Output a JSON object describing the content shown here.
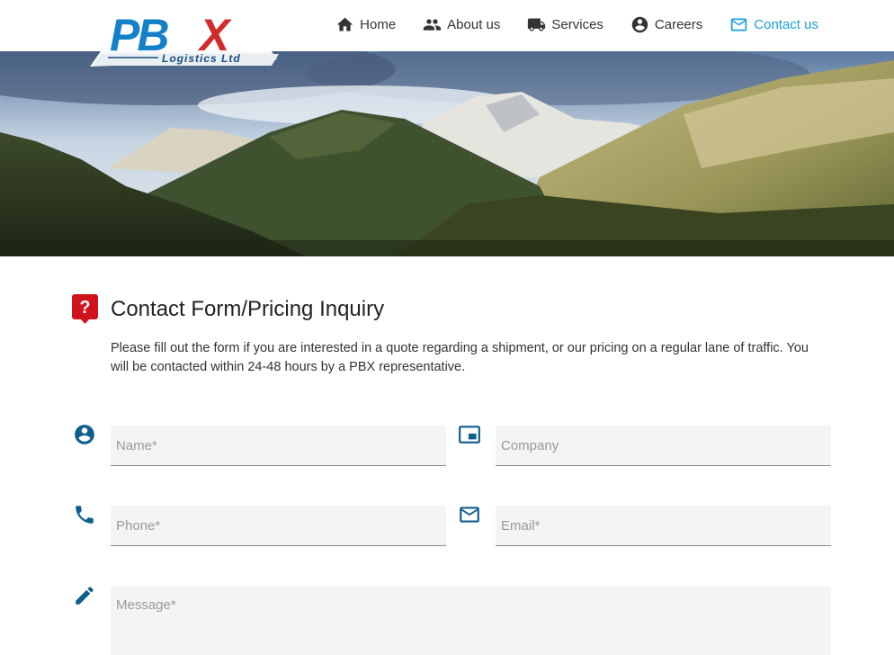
{
  "brand": {
    "logo_text": "PBX",
    "logo_subtext": "Logistics Ltd",
    "colors": {
      "blue": "#1380c8",
      "red": "#d22b2b",
      "accent": "#1aa0d8"
    }
  },
  "nav": {
    "items": [
      {
        "label": "Home",
        "icon": "home-icon"
      },
      {
        "label": "About us",
        "icon": "people-icon"
      },
      {
        "label": "Services",
        "icon": "truck-icon"
      },
      {
        "label": "Careers",
        "icon": "account-circle-icon"
      },
      {
        "label": "Contact us",
        "icon": "mail-icon",
        "active": true
      }
    ]
  },
  "main": {
    "title": "Contact Form/Pricing Inquiry",
    "intro": "Please fill out the form if you are interested in a quote regarding a shipment, or our pricing on a regular lane of traffic. You will be contacted within 24-48 hours by a PBX representative.",
    "form": {
      "name_placeholder": "Name*",
      "company_placeholder": "Company",
      "phone_placeholder": "Phone*",
      "email_placeholder": "Email*",
      "message_placeholder": "Message*"
    }
  }
}
